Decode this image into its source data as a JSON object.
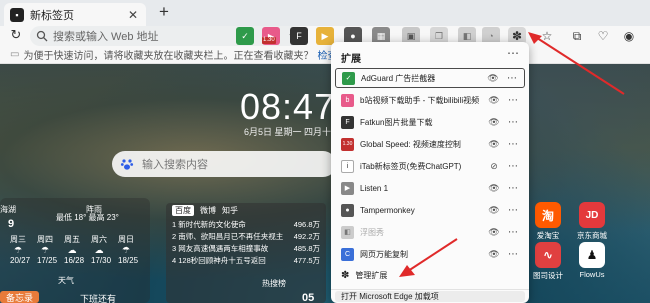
{
  "tab": {
    "title": "新标签页",
    "favicon_icon": "page-favicon"
  },
  "address": {
    "placeholder": "搜索或输入 Web 地址"
  },
  "favorites": {
    "hint": "为便于快速访问，请将收藏夹放在收藏夹栏上。正在查看收藏夹？",
    "link": "检查个人资料"
  },
  "page": {
    "clock": "08:47",
    "date": "6月5日  星期一  四月十八",
    "search_placeholder": "输入搜索内容",
    "weather": {
      "city": "海湖",
      "cond": "阵雨",
      "range": "最低 18° 最高 23°",
      "current": "9",
      "days": [
        {
          "day": "周三",
          "temp": "20/27"
        },
        {
          "day": "周四",
          "temp": "17/25"
        },
        {
          "day": "周五",
          "temp": "16/28"
        },
        {
          "day": "周六",
          "temp": "17/30"
        },
        {
          "day": "周日",
          "temp": "18/25"
        }
      ],
      "label": "天气"
    },
    "hot": {
      "tabs": [
        "百度",
        "微博",
        "知乎"
      ],
      "items": [
        {
          "text": "1 新时代新的文化使命",
          "count": "496.8万"
        },
        {
          "text": "2 南师、欲阳昌月已不再任夹视主",
          "count": "492.2万"
        },
        {
          "text": "3 网友高速偶遇两车相撞事故",
          "count": "485.8万"
        },
        {
          "text": "4 128秒回顾神舟十五号返回",
          "count": "477.5万"
        }
      ],
      "label": "热搜榜"
    },
    "memo": "备忘录",
    "bottom_label": "下班还有",
    "time_snippet": "05",
    "apps": [
      {
        "label": "爱淘宝",
        "glyph": "淘",
        "color": "#ff5a00"
      },
      {
        "label": "京东商城",
        "glyph": "JD",
        "color": "#e4393c"
      },
      {
        "label": "图司设计",
        "glyph": "∿",
        "color": "#e04040"
      },
      {
        "label": "FlowUs",
        "glyph": "♟",
        "color": "#ffffff"
      }
    ]
  },
  "extensions": {
    "title": "扩展",
    "items": [
      {
        "name": "AdGuard 广告拦截器",
        "icon_color": "#2e9a4a",
        "glyph": "✓",
        "pinned": "visible"
      },
      {
        "name": "b站视频下载助手 - 下载bilibili视频",
        "icon_color": "#e85a8a",
        "glyph": "b",
        "pinned": "visible"
      },
      {
        "name": "Fatkun图片批量下载",
        "icon_color": "#333333",
        "glyph": "F",
        "pinned": "visible"
      },
      {
        "name": "Global Speed: 视频速度控制",
        "icon_color": "#c2302f",
        "glyph": "1.30",
        "pinned": "visible"
      },
      {
        "name": "iTab新标签页(免费ChatGPT)",
        "icon_color": "#ffffff",
        "glyph": "i",
        "pinned": "hidden"
      },
      {
        "name": "Listen 1",
        "icon_color": "#888888",
        "glyph": "▶",
        "pinned": "visible"
      },
      {
        "name": "Tampermonkey",
        "icon_color": "#555555",
        "glyph": "●",
        "pinned": "visible"
      },
      {
        "name": "浮图秀",
        "icon_color": "#cccccc",
        "glyph": "◧",
        "pinned": "visible"
      },
      {
        "name": "网页万能复制",
        "icon_color": "#3a6fd8",
        "glyph": "C",
        "pinned": "visible"
      }
    ],
    "manage": "管理扩展",
    "open_addons": "打开 Microsoft Edge 加载项"
  }
}
